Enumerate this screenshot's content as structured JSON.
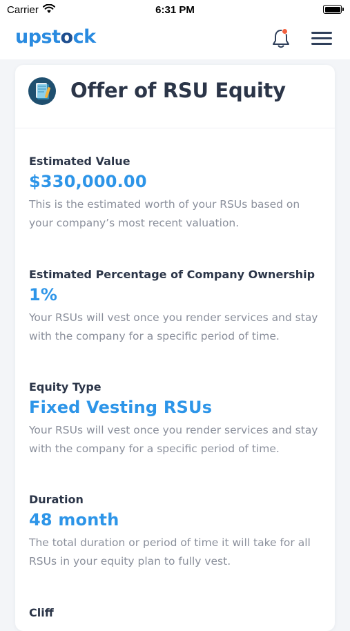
{
  "status_bar": {
    "carrier": "Carrier",
    "time": "6:31 PM"
  },
  "app_bar": {
    "logo_prefix": "upst",
    "logo_accent": "o",
    "logo_suffix": "ck",
    "brand_color": "#2a8be0",
    "notification_dot_color": "#f2603f"
  },
  "card": {
    "title": "Offer of RSU Equity",
    "icon": "document-icon"
  },
  "sections": [
    {
      "label": "Estimated Value",
      "value": "$330,000.00",
      "description": "This is the estimated worth of your RSUs based on your company’s most recent valuation."
    },
    {
      "label": "Estimated Percentage of Company Ownership",
      "value": "1%",
      "description": "Your RSUs will vest once you render services and stay with the company for a specific period of time."
    },
    {
      "label": "Equity Type",
      "value": "Fixed Vesting RSUs",
      "description": "Your RSUs will vest once you render services and stay with the company for a specific period of time."
    },
    {
      "label": "Duration",
      "value": "48 month",
      "description": "The total duration or period of time it will take for all RSUs in your equity plan to fully vest."
    },
    {
      "label": "Cliff"
    }
  ]
}
